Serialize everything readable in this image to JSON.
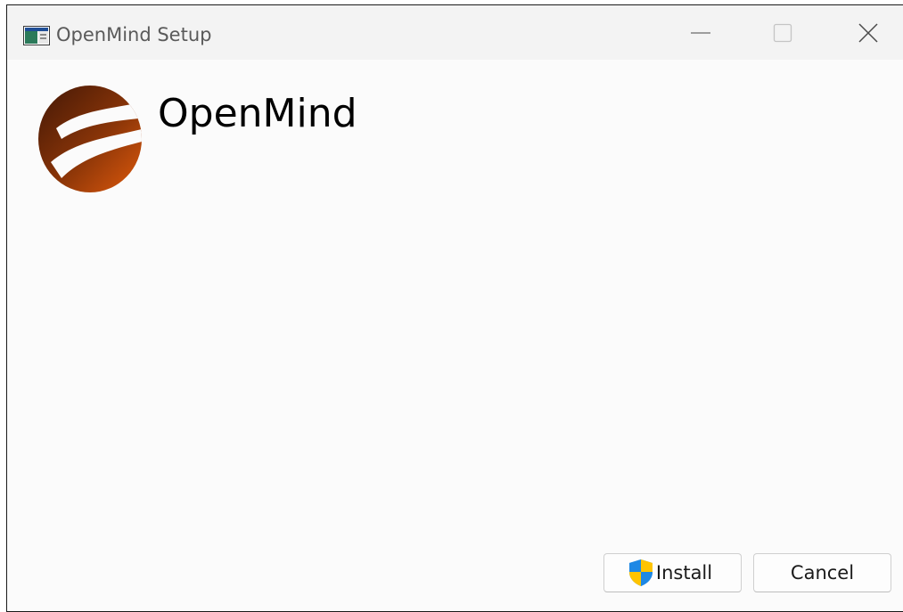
{
  "window": {
    "title": "OpenMind Setup"
  },
  "icons": {
    "app": "installer-window-icon",
    "minimize": "minimize-icon",
    "maximize": "maximize-icon",
    "close": "close-icon",
    "logo": "openmind-logo",
    "install_shield": "uac-shield-icon"
  },
  "main": {
    "product_name": "OpenMind"
  },
  "buttons": {
    "install_label": "Install",
    "cancel_label": "Cancel"
  },
  "colors": {
    "title_bar": "#f3f3f3",
    "body": "#fbfbfb",
    "logo_dark": "#4a1a08",
    "logo_light": "#d9540a",
    "shield_blue": "#1e88e5",
    "shield_yellow": "#ffc400"
  }
}
